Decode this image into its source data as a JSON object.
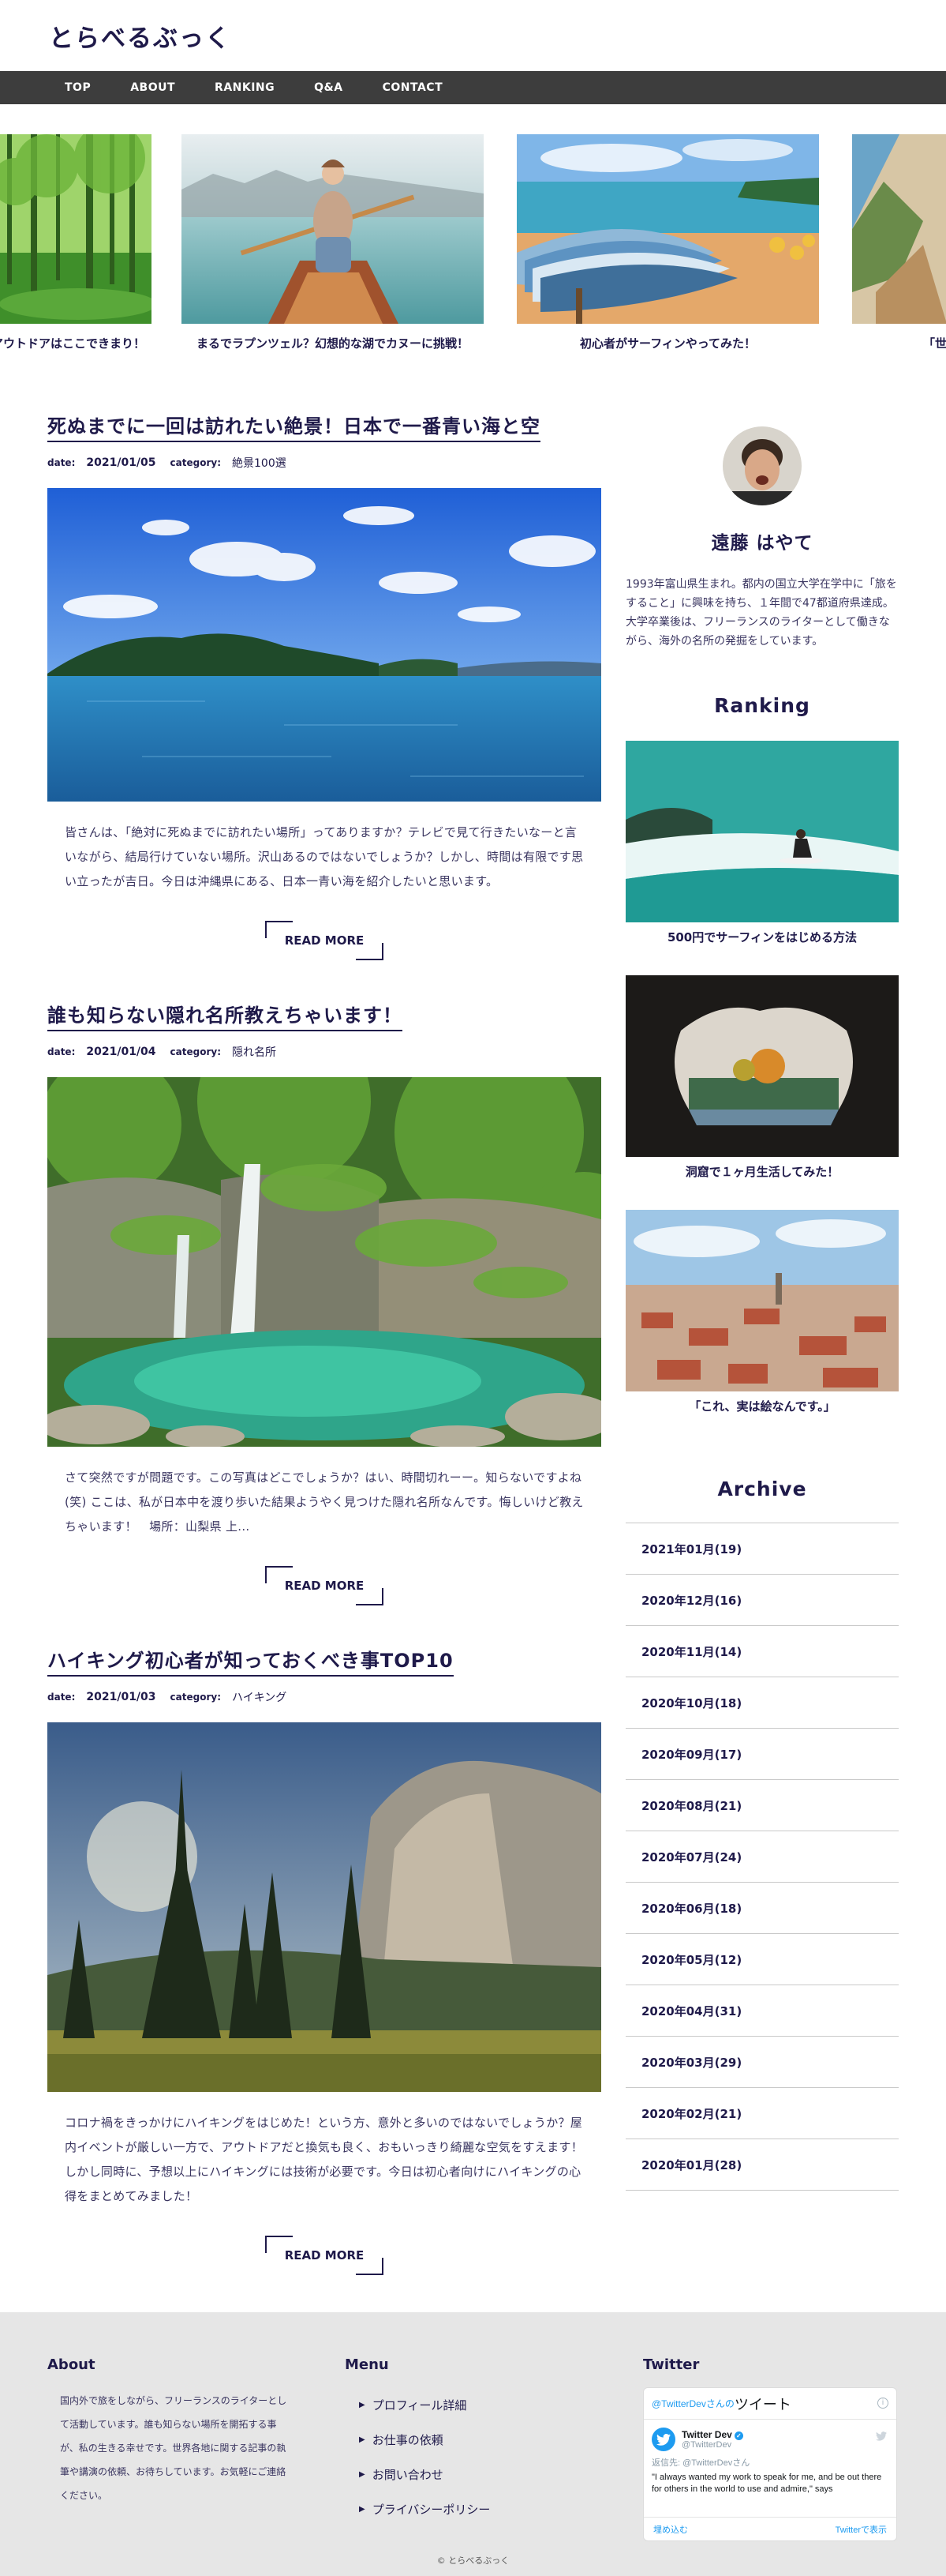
{
  "site": {
    "title": "とらべるぶっく"
  },
  "nav": {
    "items": [
      "TOP",
      "ABOUT",
      "RANKING",
      "Q&A",
      "CONTACT"
    ]
  },
  "slider": {
    "slides": [
      {
        "caption": "アウトドアはここできまり！"
      },
      {
        "caption": "まるでラプンツェル？幻想的な湖でカヌーに挑戦！"
      },
      {
        "caption": "初心者がサーフィンやってみた！"
      },
      {
        "caption": "「世"
      }
    ]
  },
  "posts": [
    {
      "title": "死ぬまでに一回は訪れたい絶景！日本で一番青い海と空",
      "date_key": "date:",
      "date": "2021/01/05",
      "category_key": "category:",
      "category": "絶景100選",
      "excerpt": "皆さんは、「絶対に死ぬまでに訪れたい場所」ってありますか？テレビで見て行きたいなーと言いながら、結局行けていない場所。沢山あるのではないでしょうか？しかし、時間は有限です思い立ったが吉日。今日は沖縄県にある、日本一青い海を紹介したいと思います。",
      "read_more": "READ MORE"
    },
    {
      "title": "誰も知らない隠れ名所教えちゃいます！",
      "date_key": "date:",
      "date": "2021/01/04",
      "category_key": "category:",
      "category": "隠れ名所",
      "excerpt": "さて突然ですが問題です。この写真はどこでしょうか？はい、時間切れーー。知らないですよね(笑) ここは、私が日本中を渡り歩いた結果ようやく見つけた隠れ名所なんです。悔しいけど教えちゃいます！　場所：山梨県 上...",
      "read_more": "READ MORE"
    },
    {
      "title": "ハイキング初心者が知っておくべき事TOP10",
      "date_key": "date:",
      "date": "2021/01/03",
      "category_key": "category:",
      "category": "ハイキング",
      "excerpt": "コロナ禍をきっかけにハイキングをはじめた！という方、意外と多いのではないでしょうか？屋内イベントが厳しい一方で、アウトドアだと換気も良く、おもいっきり綺麗な空気をすえます！しかし同時に、予想以上にハイキングには技術が必要です。今日は初心者向けにハイキングの心得をまとめてみました！",
      "read_more": "READ MORE"
    }
  ],
  "profile": {
    "name": "遠藤 はやて",
    "bio": "1993年富山県生まれ。都内の国立大学在学中に「旅をすること」に興味を持ち、１年間で47都道府県達成。大学卒業後は、フリーランスのライターとして働きながら、海外の名所の発掘をしています。"
  },
  "ranking": {
    "heading": "Ranking",
    "items": [
      {
        "caption": "500円でサーフィンをはじめる方法"
      },
      {
        "caption": "洞窟で１ヶ月生活してみた！"
      },
      {
        "caption": "「これ、実は絵なんです。」"
      }
    ]
  },
  "archive": {
    "heading": "Archive",
    "items": [
      "2021年01月(19)",
      "2020年12月(16)",
      "2020年11月(14)",
      "2020年10月(18)",
      "2020年09月(17)",
      "2020年08月(21)",
      "2020年07月(24)",
      "2020年06月(18)",
      "2020年05月(12)",
      "2020年04月(31)",
      "2020年03月(29)",
      "2020年02月(21)",
      "2020年01月(28)"
    ]
  },
  "footer": {
    "about_heading": "About",
    "about_text": "国内外で旅をしながら、フリーランスのライターとして活動しています。誰も知らない場所を開拓する事が、私の生きる幸せです。世界各地に関する記事の執筆や講演の依頼、お待ちしています。お気軽にご連絡ください。",
    "menu_heading": "Menu",
    "menu_items": [
      "プロフィール詳細",
      "お仕事の依頼",
      "お問い合わせ",
      "プライバシーポリシー"
    ],
    "twitter_heading": "Twitter",
    "copyright": "© とらべるぶっく"
  },
  "twitter_widget": {
    "header_prefix": "@TwitterDevさんの",
    "header_big": "ツイート",
    "user_name": "Twitter Dev",
    "user_handle": "@TwitterDev",
    "reply_prefix": "返信先: ",
    "reply_handle": "@TwitterDevさん",
    "tweet_text": "\"I always wanted my work to speak for me, and be out there for others in the world to use and admire,\" says",
    "embed_label": "埋め込む",
    "view_label": "Twitterで表示"
  },
  "colors": {
    "nav_bg": "#3d3d3d",
    "text_navy": "#1f1a4a",
    "footer_bg": "#e6e6e6",
    "twitter_blue": "#1d9bf0"
  }
}
